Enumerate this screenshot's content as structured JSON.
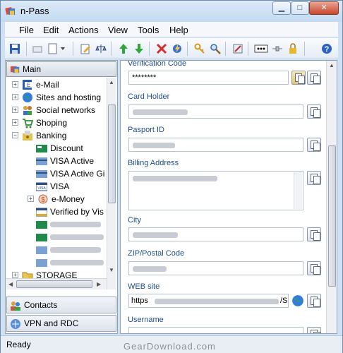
{
  "window": {
    "title": "n-Pass"
  },
  "menu": [
    "File",
    "Edit",
    "Actions",
    "View",
    "Tools",
    "Help"
  ],
  "left": {
    "main_label": "Main",
    "tree": [
      {
        "label": "e-Mail",
        "icon": "email-icon"
      },
      {
        "label": "Sites and hosting",
        "icon": "globe-icon"
      },
      {
        "label": "Social networks",
        "icon": "people-icon"
      },
      {
        "label": "Shoping",
        "icon": "cart-icon"
      },
      {
        "label": "Banking",
        "icon": "bank-icon"
      },
      {
        "label": "Discount",
        "icon": "card-icon"
      },
      {
        "label": "VISA Active",
        "icon": "card-icon"
      },
      {
        "label": "VISA Active Gi",
        "icon": "card-icon"
      },
      {
        "label": "VISA",
        "icon": "visa-card-icon"
      },
      {
        "label": "e-Money",
        "icon": "money-icon"
      },
      {
        "label": "Verified by Vis",
        "icon": "visa-card-icon"
      },
      {
        "label": "",
        "icon": "card-icon"
      },
      {
        "label": "",
        "icon": "card-icon"
      },
      {
        "label": "",
        "icon": "card-icon"
      },
      {
        "label": "",
        "icon": "card-icon"
      },
      {
        "label": "STORAGE",
        "icon": "folder-icon"
      }
    ],
    "contacts_label": "Contacts",
    "vpn_label": "VPN and RDC"
  },
  "form": {
    "verification_code_label": "Verification Code",
    "verification_code_value": "********",
    "card_holder_label": "Card Holder",
    "passport_label": "Pasport ID",
    "billing_label": "Billing Address",
    "city_label": "City",
    "zip_label": "ZIP/Postal Code",
    "web_label": "WEB site",
    "web_prefix": "https",
    "web_suffix": "/S",
    "username_label": "Username"
  },
  "status": {
    "text": "Ready"
  },
  "watermark": "GearDownload.com"
}
